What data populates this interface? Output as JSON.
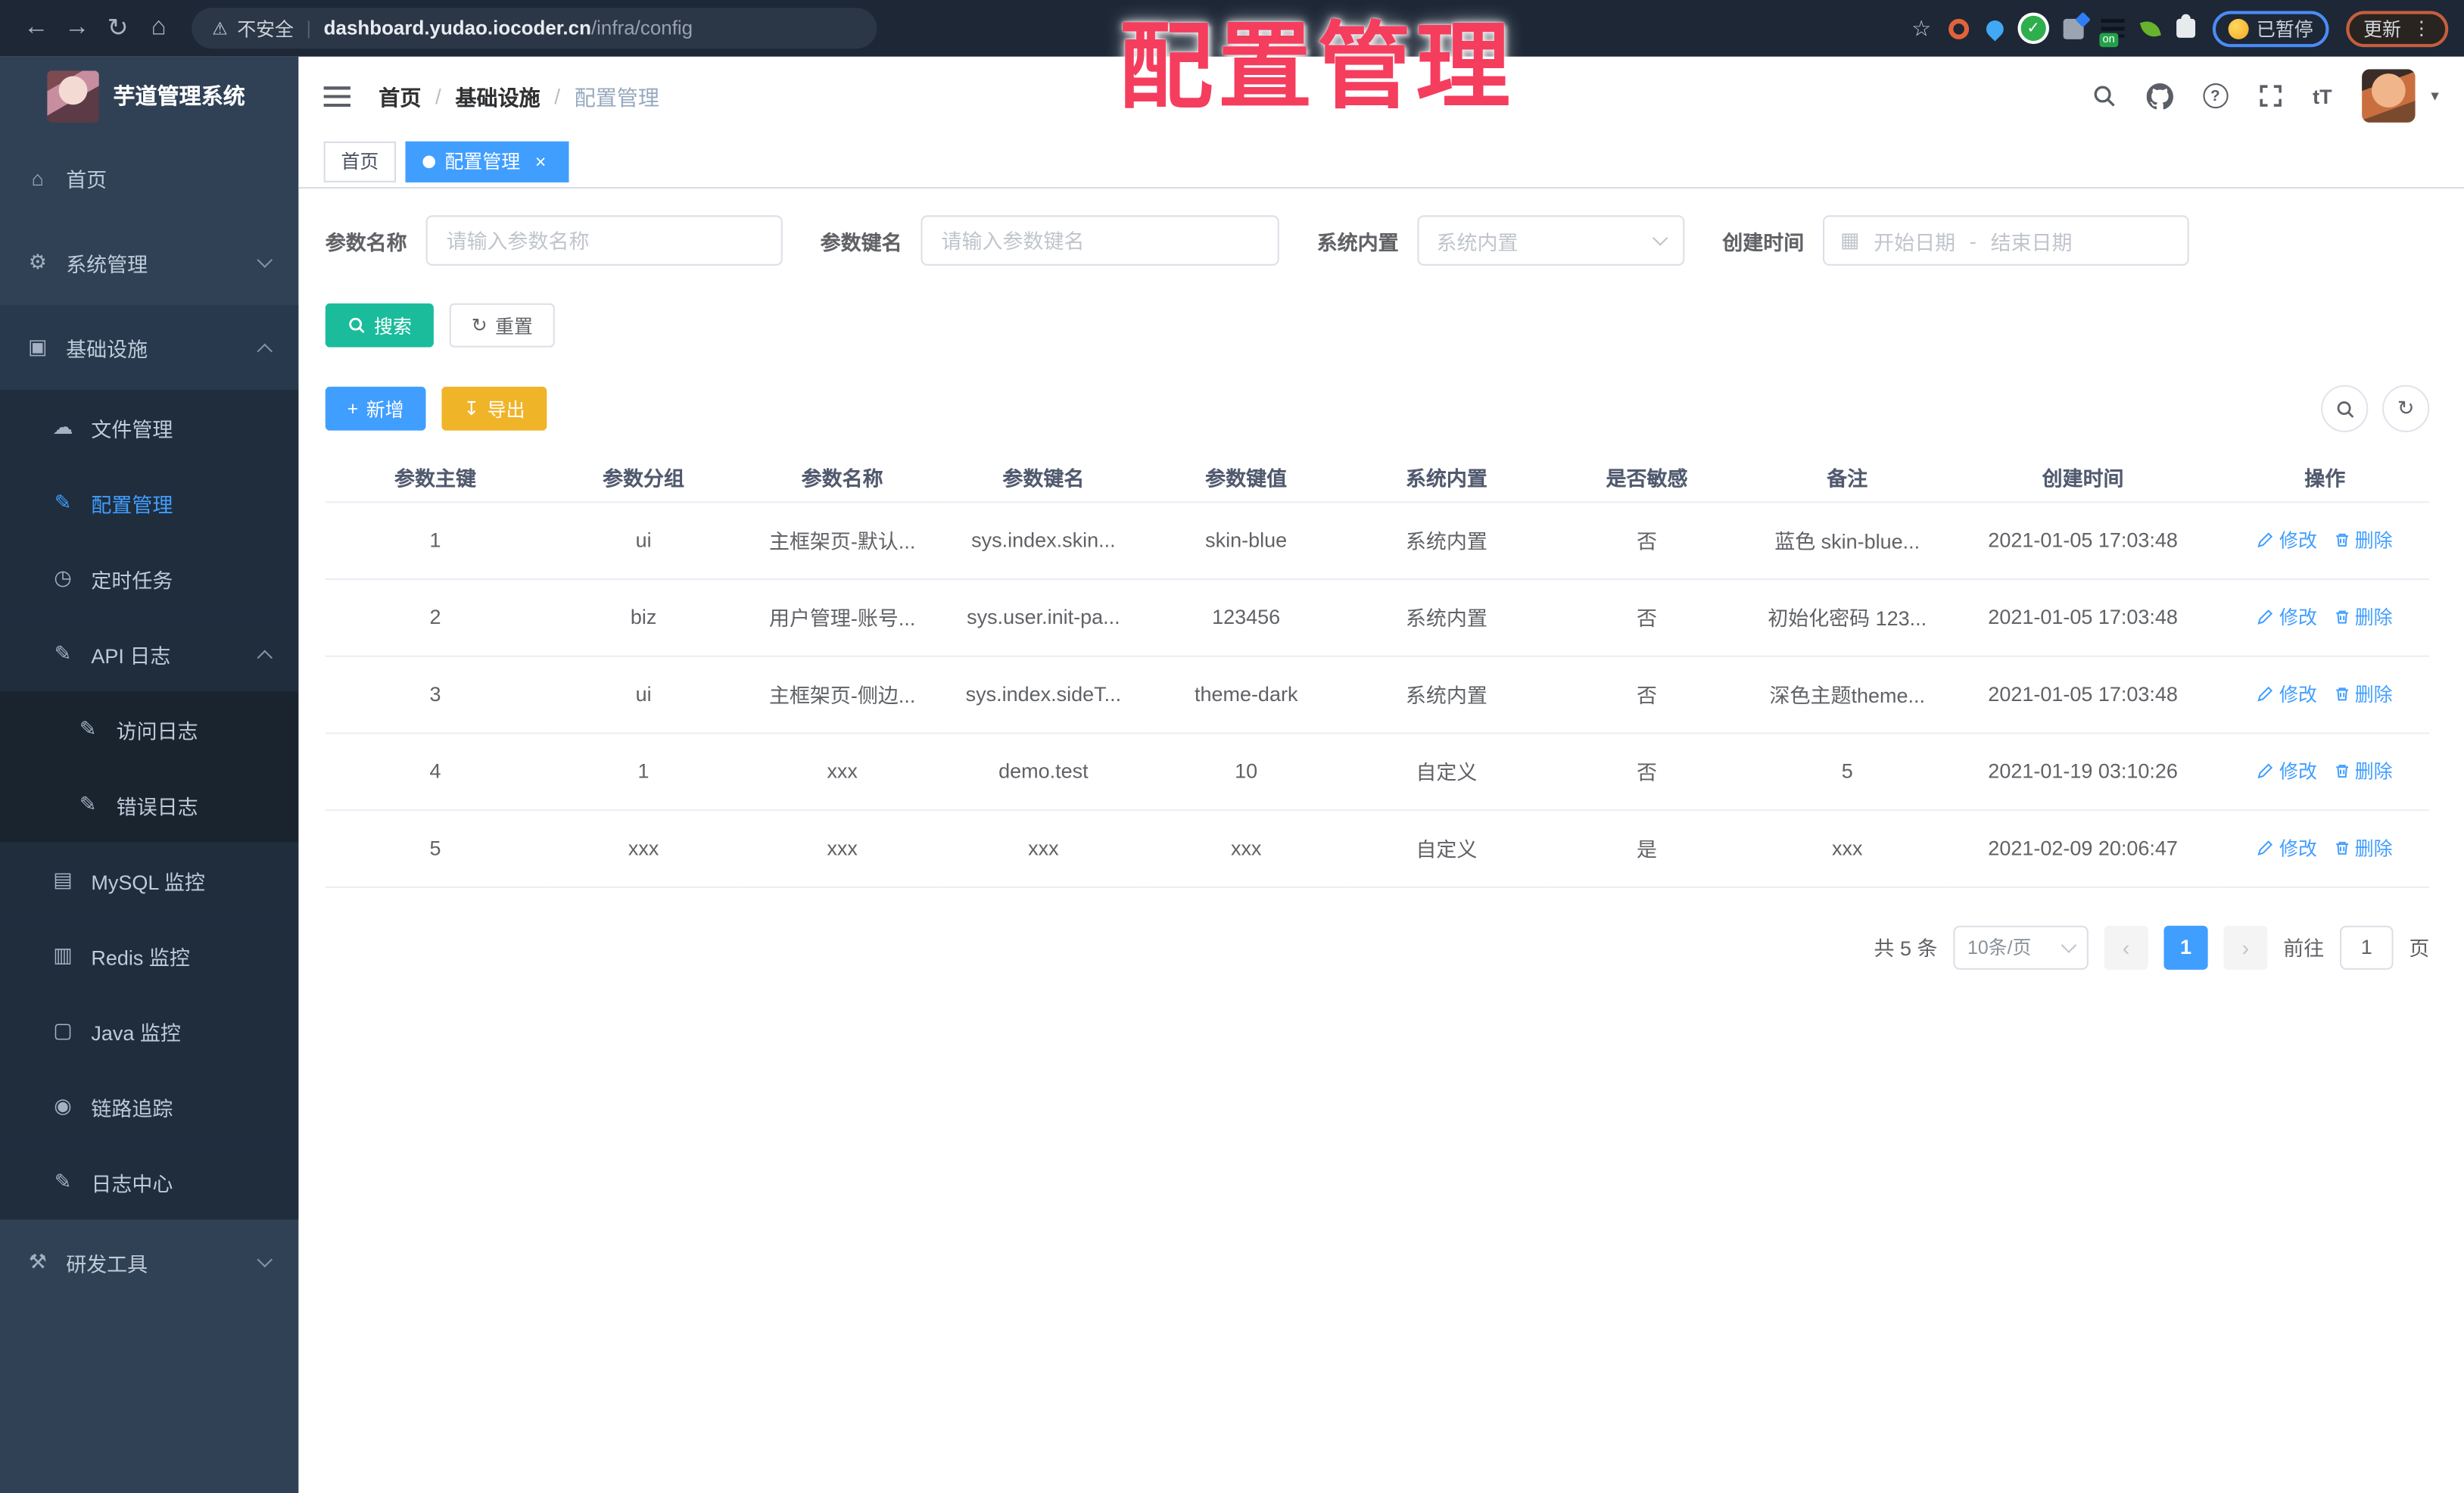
{
  "browser": {
    "security_label": "不安全",
    "url_host": "dashboard.yudao.iocoder.cn",
    "url_path": "/infra/config",
    "paused_label": "已暂停",
    "update_label": "更新",
    "ext_on_label": "on",
    "icons": {
      "back": "←",
      "forward": "→",
      "reload": "↻",
      "home": "⌂",
      "warning": "⚠",
      "divider": "|",
      "star": "☆",
      "kebab": "⋮"
    }
  },
  "annotation": {
    "text": "配置管理",
    "color": "#f53d5e"
  },
  "sidebar": {
    "title": "芋道管理系统",
    "items": [
      {
        "label": "首页",
        "icon": "⌂",
        "level": 0,
        "chevron": null,
        "active": false,
        "section": false
      },
      {
        "label": "系统管理",
        "icon": "⚙",
        "level": 0,
        "chevron": "down",
        "active": false,
        "section": false
      },
      {
        "label": "基础设施",
        "icon": "▣",
        "level": 0,
        "chevron": "up",
        "active": false,
        "section": true
      },
      {
        "label": "文件管理",
        "icon": "☁",
        "level": 1,
        "chevron": null,
        "active": false,
        "section": false
      },
      {
        "label": "配置管理",
        "icon": "✎",
        "level": 1,
        "chevron": null,
        "active": true,
        "section": false
      },
      {
        "label": "定时任务",
        "icon": "◷",
        "level": 1,
        "chevron": null,
        "active": false,
        "section": false
      },
      {
        "label": "API 日志",
        "icon": "✎",
        "level": 1,
        "chevron": "up",
        "active": false,
        "section": false
      },
      {
        "label": "访问日志",
        "icon": "✎",
        "level": 2,
        "chevron": null,
        "active": false,
        "section": false
      },
      {
        "label": "错误日志",
        "icon": "✎",
        "level": 2,
        "chevron": null,
        "active": false,
        "section": false
      },
      {
        "label": "MySQL 监控",
        "icon": "▤",
        "level": 1,
        "chevron": null,
        "active": false,
        "section": false
      },
      {
        "label": "Redis 监控",
        "icon": "▥",
        "level": 1,
        "chevron": null,
        "active": false,
        "section": false
      },
      {
        "label": "Java 监控",
        "icon": "▢",
        "level": 1,
        "chevron": null,
        "active": false,
        "section": false
      },
      {
        "label": "链路追踪",
        "icon": "◉",
        "level": 1,
        "chevron": null,
        "active": false,
        "section": false
      },
      {
        "label": "日志中心",
        "icon": "✎",
        "level": 1,
        "chevron": null,
        "active": false,
        "section": false
      },
      {
        "label": "研发工具",
        "icon": "⚒",
        "level": 0,
        "chevron": "down",
        "active": false,
        "section": false
      }
    ]
  },
  "navbar": {
    "breadcrumb": [
      "首页",
      "基础设施",
      "配置管理"
    ],
    "breadcrumb_separator": "/",
    "fontsize_icon": "tT",
    "question_icon": "?",
    "caret_icon": "▾"
  },
  "tabs": [
    {
      "label": "首页",
      "active": false,
      "closable": false
    },
    {
      "label": "配置管理",
      "active": true,
      "closable": true
    }
  ],
  "tab_close_icon": "×",
  "filters": {
    "name_label": "参数名称",
    "name_placeholder": "请输入参数名称",
    "key_label": "参数键名",
    "key_placeholder": "请输入参数键名",
    "type_label": "系统内置",
    "type_placeholder": "系统内置",
    "date_label": "创建时间",
    "date_start_placeholder": "开始日期",
    "date_separator": "-",
    "date_end_placeholder": "结束日期",
    "calendar_icon": "▦",
    "search_label": "搜索",
    "reset_label": "重置",
    "reset_icon": "↻"
  },
  "toolbar": {
    "add_label": "新增",
    "add_icon": "+",
    "export_label": "导出",
    "export_icon": "↧",
    "refresh_icon": "↻"
  },
  "table": {
    "columns": [
      "参数主键",
      "参数分组",
      "参数名称",
      "参数键名",
      "参数键值",
      "系统内置",
      "是否敏感",
      "备注",
      "创建时间",
      "操作"
    ],
    "rows": [
      [
        "1",
        "ui",
        "主框架页-默认...",
        "sys.index.skin...",
        "skin-blue",
        "系统内置",
        "否",
        "蓝色 skin-blue...",
        "2021-01-05 17:03:48"
      ],
      [
        "2",
        "biz",
        "用户管理-账号...",
        "sys.user.init-pa...",
        "123456",
        "系统内置",
        "否",
        "初始化密码 123...",
        "2021-01-05 17:03:48"
      ],
      [
        "3",
        "ui",
        "主框架页-侧边...",
        "sys.index.sideT...",
        "theme-dark",
        "系统内置",
        "否",
        "深色主题theme...",
        "2021-01-05 17:03:48"
      ],
      [
        "4",
        "1",
        "xxx",
        "demo.test",
        "10",
        "自定义",
        "否",
        "5",
        "2021-01-19 03:10:26"
      ],
      [
        "5",
        "xxx",
        "xxx",
        "xxx",
        "xxx",
        "自定义",
        "是",
        "xxx",
        "2021-02-09 20:06:47"
      ]
    ],
    "edit_label": "修改",
    "delete_label": "删除"
  },
  "pagination": {
    "total_label": "共 5 条",
    "page_size": "10条/页",
    "prev_icon": "‹",
    "next_icon": "›",
    "current_page": "1",
    "goto_label": "前往",
    "goto_value": "1",
    "page_label": "页"
  },
  "colors": {
    "accent": "#409eff",
    "search_button": "#1abc9c",
    "export_button": "#f0b429",
    "sidebar_bg": "#304156",
    "submenu_bg": "#1f2d3d",
    "annotation": "#f53d5e"
  }
}
